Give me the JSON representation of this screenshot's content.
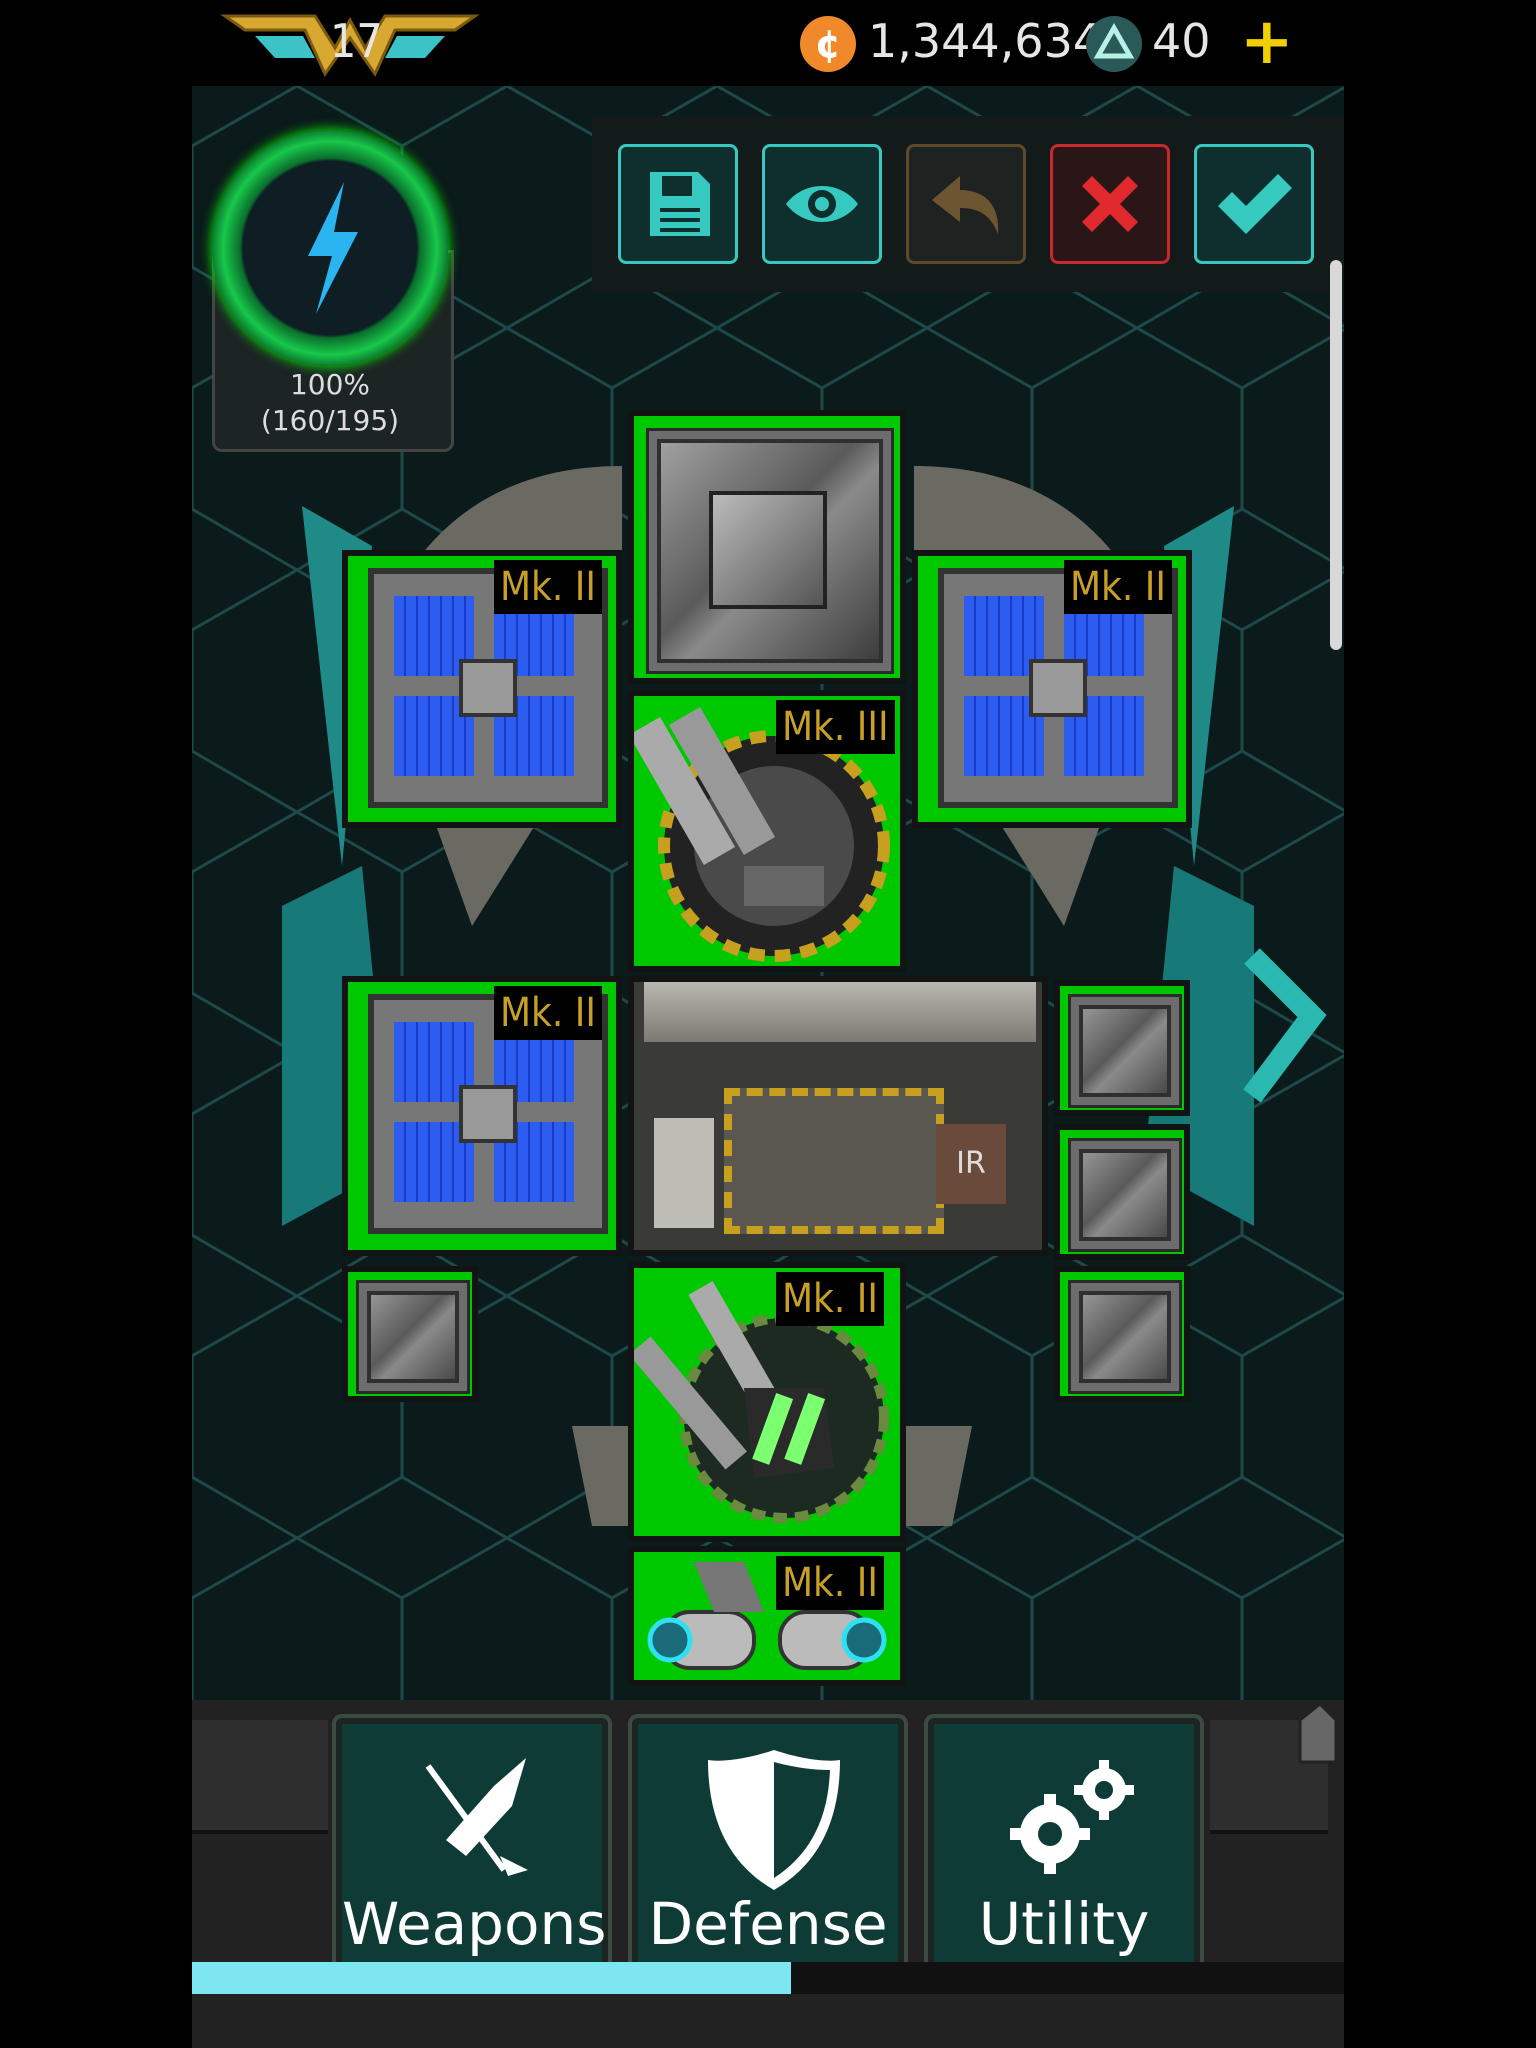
{
  "header": {
    "rank_level": "17",
    "credits": "1,344,634",
    "gems": "40",
    "add_symbol": "+"
  },
  "power": {
    "percent": "100%",
    "count": "(160/195)"
  },
  "toolbar": {
    "buttons": [
      "save-icon",
      "eye-icon",
      "undo-icon",
      "close-icon",
      "check-icon"
    ]
  },
  "modules": {
    "solar_left_top": "Mk. II",
    "turret_top": "Mk. III",
    "solar_right_top": "Mk. II",
    "solar_left_mid": "Mk. II",
    "turret_bottom": "Mk. II",
    "engine": "Mk. II"
  },
  "tabs": {
    "weapons": "Weapons",
    "defense": "Defense",
    "utility": "Utility"
  },
  "progress": {
    "fraction": 0.52
  },
  "colors": {
    "slot_green": "#00c800",
    "accent_teal": "#36c9c0",
    "coin_orange": "#f0892a",
    "rank_gold": "#f0d000",
    "label_gold": "#c8a028"
  }
}
